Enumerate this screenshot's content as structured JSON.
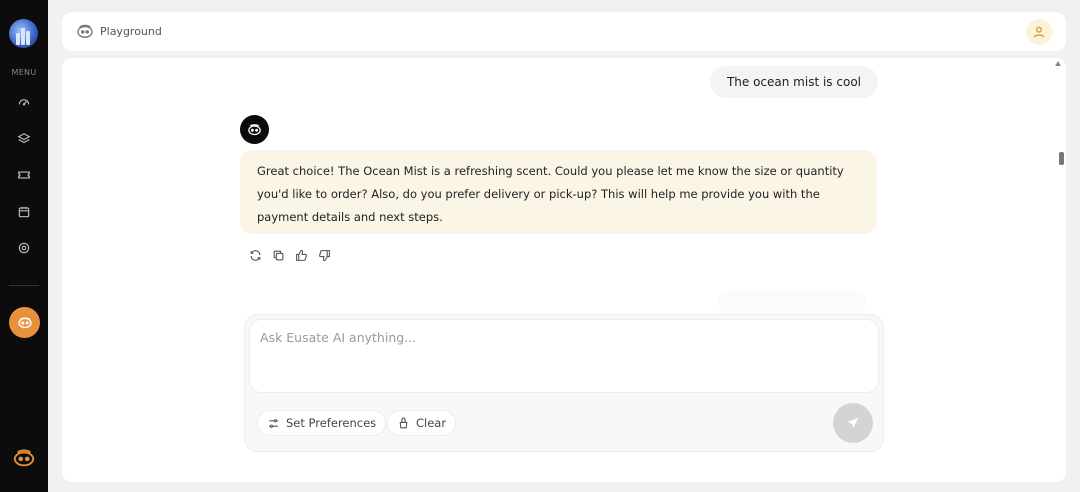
{
  "sidebar": {
    "menu_label": "MENU",
    "items": [
      {
        "icon": "gauge-icon"
      },
      {
        "icon": "layers-icon"
      },
      {
        "icon": "ticket-icon"
      },
      {
        "icon": "calendar-icon"
      },
      {
        "icon": "settings-icon"
      }
    ],
    "active_bot_color": "#e8913d"
  },
  "header": {
    "title": "Playground"
  },
  "conversation": {
    "user_message": "The ocean mist is cool",
    "bot_message": "Great choice! The Ocean Mist is a refreshing scent. Could you please let me know the size or quantity you'd like to order? Also, do you prefer delivery or pick-up? This will help me provide you with the payment details and next steps.",
    "bot_bubble_color": "#faf5e4"
  },
  "composer": {
    "placeholder": "Ask Eusate AI anything...",
    "value": "",
    "set_preferences_label": "Set Preferences",
    "clear_label": "Clear"
  }
}
